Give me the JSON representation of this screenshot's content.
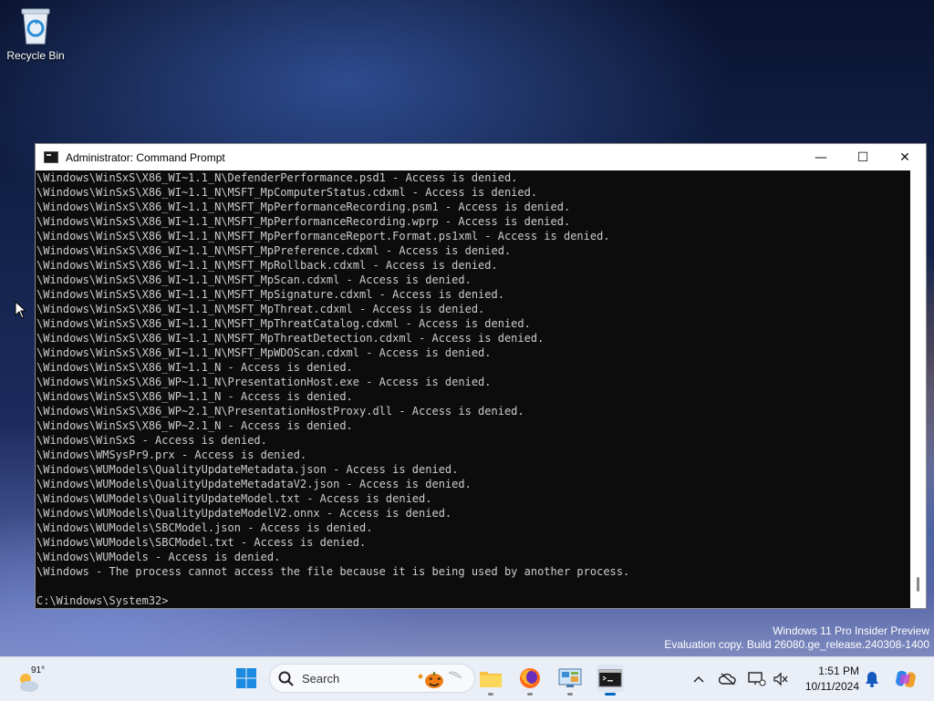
{
  "desktop": {
    "recycle_bin_label": "Recycle Bin"
  },
  "window": {
    "title": "Administrator: Command Prompt",
    "minimize_glyph": "—",
    "maximize_glyph": "☐",
    "close_glyph": "✕"
  },
  "console": {
    "lines": [
      "\\Windows\\WinSxS\\X86_WI~1.1_N\\DefenderPerformance.psd1 - Access is denied.",
      "\\Windows\\WinSxS\\X86_WI~1.1_N\\MSFT_MpComputerStatus.cdxml - Access is denied.",
      "\\Windows\\WinSxS\\X86_WI~1.1_N\\MSFT_MpPerformanceRecording.psm1 - Access is denied.",
      "\\Windows\\WinSxS\\X86_WI~1.1_N\\MSFT_MpPerformanceRecording.wprp - Access is denied.",
      "\\Windows\\WinSxS\\X86_WI~1.1_N\\MSFT_MpPerformanceReport.Format.ps1xml - Access is denied.",
      "\\Windows\\WinSxS\\X86_WI~1.1_N\\MSFT_MpPreference.cdxml - Access is denied.",
      "\\Windows\\WinSxS\\X86_WI~1.1_N\\MSFT_MpRollback.cdxml - Access is denied.",
      "\\Windows\\WinSxS\\X86_WI~1.1_N\\MSFT_MpScan.cdxml - Access is denied.",
      "\\Windows\\WinSxS\\X86_WI~1.1_N\\MSFT_MpSignature.cdxml - Access is denied.",
      "\\Windows\\WinSxS\\X86_WI~1.1_N\\MSFT_MpThreat.cdxml - Access is denied.",
      "\\Windows\\WinSxS\\X86_WI~1.1_N\\MSFT_MpThreatCatalog.cdxml - Access is denied.",
      "\\Windows\\WinSxS\\X86_WI~1.1_N\\MSFT_MpThreatDetection.cdxml - Access is denied.",
      "\\Windows\\WinSxS\\X86_WI~1.1_N\\MSFT_MpWDOScan.cdxml - Access is denied.",
      "\\Windows\\WinSxS\\X86_WI~1.1_N - Access is denied.",
      "\\Windows\\WinSxS\\X86_WP~1.1_N\\PresentationHost.exe - Access is denied.",
      "\\Windows\\WinSxS\\X86_WP~1.1_N - Access is denied.",
      "\\Windows\\WinSxS\\X86_WP~2.1_N\\PresentationHostProxy.dll - Access is denied.",
      "\\Windows\\WinSxS\\X86_WP~2.1_N - Access is denied.",
      "\\Windows\\WinSxS - Access is denied.",
      "\\Windows\\WMSysPr9.prx - Access is denied.",
      "\\Windows\\WUModels\\QualityUpdateMetadata.json - Access is denied.",
      "\\Windows\\WUModels\\QualityUpdateMetadataV2.json - Access is denied.",
      "\\Windows\\WUModels\\QualityUpdateModel.txt - Access is denied.",
      "\\Windows\\WUModels\\QualityUpdateModelV2.onnx - Access is denied.",
      "\\Windows\\WUModels\\SBCModel.json - Access is denied.",
      "\\Windows\\WUModels\\SBCModel.txt - Access is denied.",
      "\\Windows\\WUModels - Access is denied.",
      "\\Windows - The process cannot access the file because it is being used by another process.",
      "",
      "C:\\Windows\\System32>"
    ]
  },
  "watermark": {
    "line1": "Windows 11 Pro Insider Preview",
    "line2": "Evaluation copy. Build 26080.ge_release.240308-1400"
  },
  "taskbar": {
    "weather_temp": "91°",
    "search_placeholder": "Search",
    "clock_time": "1:51 PM",
    "clock_date": "10/11/2024"
  },
  "colors": {
    "console_bg": "#0c0c0c",
    "console_text": "#cccccc",
    "taskbar_bg": "#e9eef7",
    "accent": "#0067c0"
  }
}
